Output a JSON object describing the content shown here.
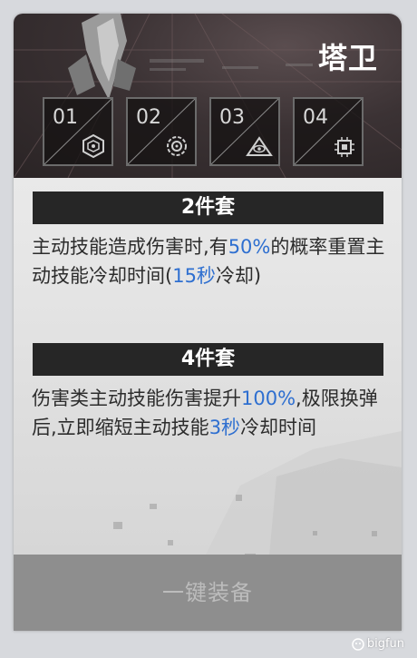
{
  "set": {
    "name": "塔卫"
  },
  "slots": [
    {
      "number": "01",
      "icon": "hexagon-gear-icon"
    },
    {
      "number": "02",
      "icon": "circular-gear-icon"
    },
    {
      "number": "03",
      "icon": "eye-triangle-icon"
    },
    {
      "number": "04",
      "icon": "microchip-icon"
    }
  ],
  "bonuses": [
    {
      "header": "2件套",
      "text_parts": [
        {
          "t": "主动技能造成伤害时,有"
        },
        {
          "t": "50%",
          "hl": true
        },
        {
          "t": "的概率重置主动技能冷却时间("
        },
        {
          "t": "15秒",
          "hl": true
        },
        {
          "t": "冷却)"
        }
      ]
    },
    {
      "header": "4件套",
      "text_parts": [
        {
          "t": "伤害类主动技能伤害提升"
        },
        {
          "t": "100%",
          "hl": true
        },
        {
          "t": ",极限换弹后,立即缩短主动技能"
        },
        {
          "t": "3秒",
          "hl": true
        },
        {
          "t": "冷却时间"
        }
      ]
    }
  ],
  "button": {
    "equip_label": "一键装备"
  },
  "watermark": {
    "text": "bigfun",
    "icon": "bigfun-logo-icon"
  },
  "colors": {
    "highlight": "#2e6fd0",
    "header_bar": "#262626",
    "button_bg": "#8e8e8e"
  }
}
